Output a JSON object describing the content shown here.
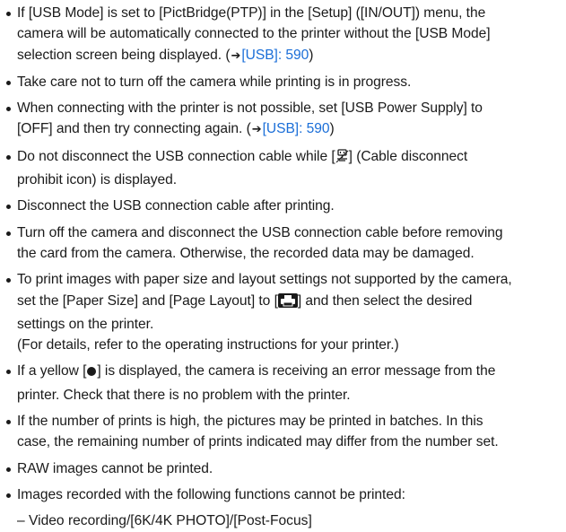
{
  "notes": [
    {
      "lines": [
        [
          {
            "t": "If [USB Mode] is set to [PictBridge(PTP)] in the [Setup] ([IN/OUT]) menu, the"
          }
        ],
        [
          {
            "t": "camera will be automatically connected to the printer without the [USB Mode]"
          }
        ],
        [
          {
            "t": "selection screen being displayed. ("
          },
          {
            "icon": "arrow"
          },
          {
            "t": "[USB]: 590",
            "link": true
          },
          {
            "t": ")"
          }
        ]
      ]
    },
    {
      "lines": [
        [
          {
            "t": "Take care not to turn off the camera while printing is in progress."
          }
        ]
      ]
    },
    {
      "lines": [
        [
          {
            "t": "When connecting with the printer is not possible, set [USB Power Supply] to"
          }
        ],
        [
          {
            "t": "[OFF] and then try connecting again. ("
          },
          {
            "icon": "arrow"
          },
          {
            "t": "[USB]: 590",
            "link": true
          },
          {
            "t": ")"
          }
        ]
      ]
    },
    {
      "lines": [
        [
          {
            "t": "Do not disconnect the USB connection cable while ["
          },
          {
            "icon": "cable-disconnect-prohibit"
          },
          {
            "t": "] (Cable disconnect"
          }
        ],
        [
          {
            "t": "prohibit icon) is displayed."
          }
        ]
      ]
    },
    {
      "lines": [
        [
          {
            "t": "Disconnect the USB connection cable after printing."
          }
        ]
      ]
    },
    {
      "lines": [
        [
          {
            "t": "Turn off the camera and disconnect the USB connection cable before removing"
          }
        ],
        [
          {
            "t": "the card from the camera. Otherwise, the recorded data may be damaged."
          }
        ]
      ]
    },
    {
      "lines": [
        [
          {
            "t": "To print images with paper size and layout settings not supported by the camera,"
          }
        ],
        [
          {
            "t": "set the [Paper Size] and [Page Layout] to ["
          },
          {
            "icon": "printer"
          },
          {
            "t": "] and then select the desired"
          }
        ],
        [
          {
            "t": "settings on the printer."
          }
        ],
        [
          {
            "t": "(For details, refer to the operating instructions for your printer.)"
          }
        ]
      ]
    },
    {
      "lines": [
        [
          {
            "t": "If a yellow ["
          },
          {
            "icon": "circle"
          },
          {
            "t": "] is displayed, the camera is receiving an error message from the"
          }
        ],
        [
          {
            "t": "printer. Check that there is no problem with the printer."
          }
        ]
      ]
    },
    {
      "lines": [
        [
          {
            "t": "If the number of prints is high, the pictures may be printed in batches. In this"
          }
        ],
        [
          {
            "t": "case, the remaining number of prints indicated may differ from the number set."
          }
        ]
      ]
    },
    {
      "lines": [
        [
          {
            "t": "RAW images cannot be printed."
          }
        ]
      ]
    },
    {
      "lines": [
        [
          {
            "t": "Images recorded with the following functions cannot be printed:"
          }
        ]
      ]
    }
  ],
  "sub_items": [
    "– Video recording/[6K/4K PHOTO]/[Post-Focus]"
  ],
  "colors": {
    "text": "#1a1a1a",
    "link": "#1a6ed8"
  }
}
